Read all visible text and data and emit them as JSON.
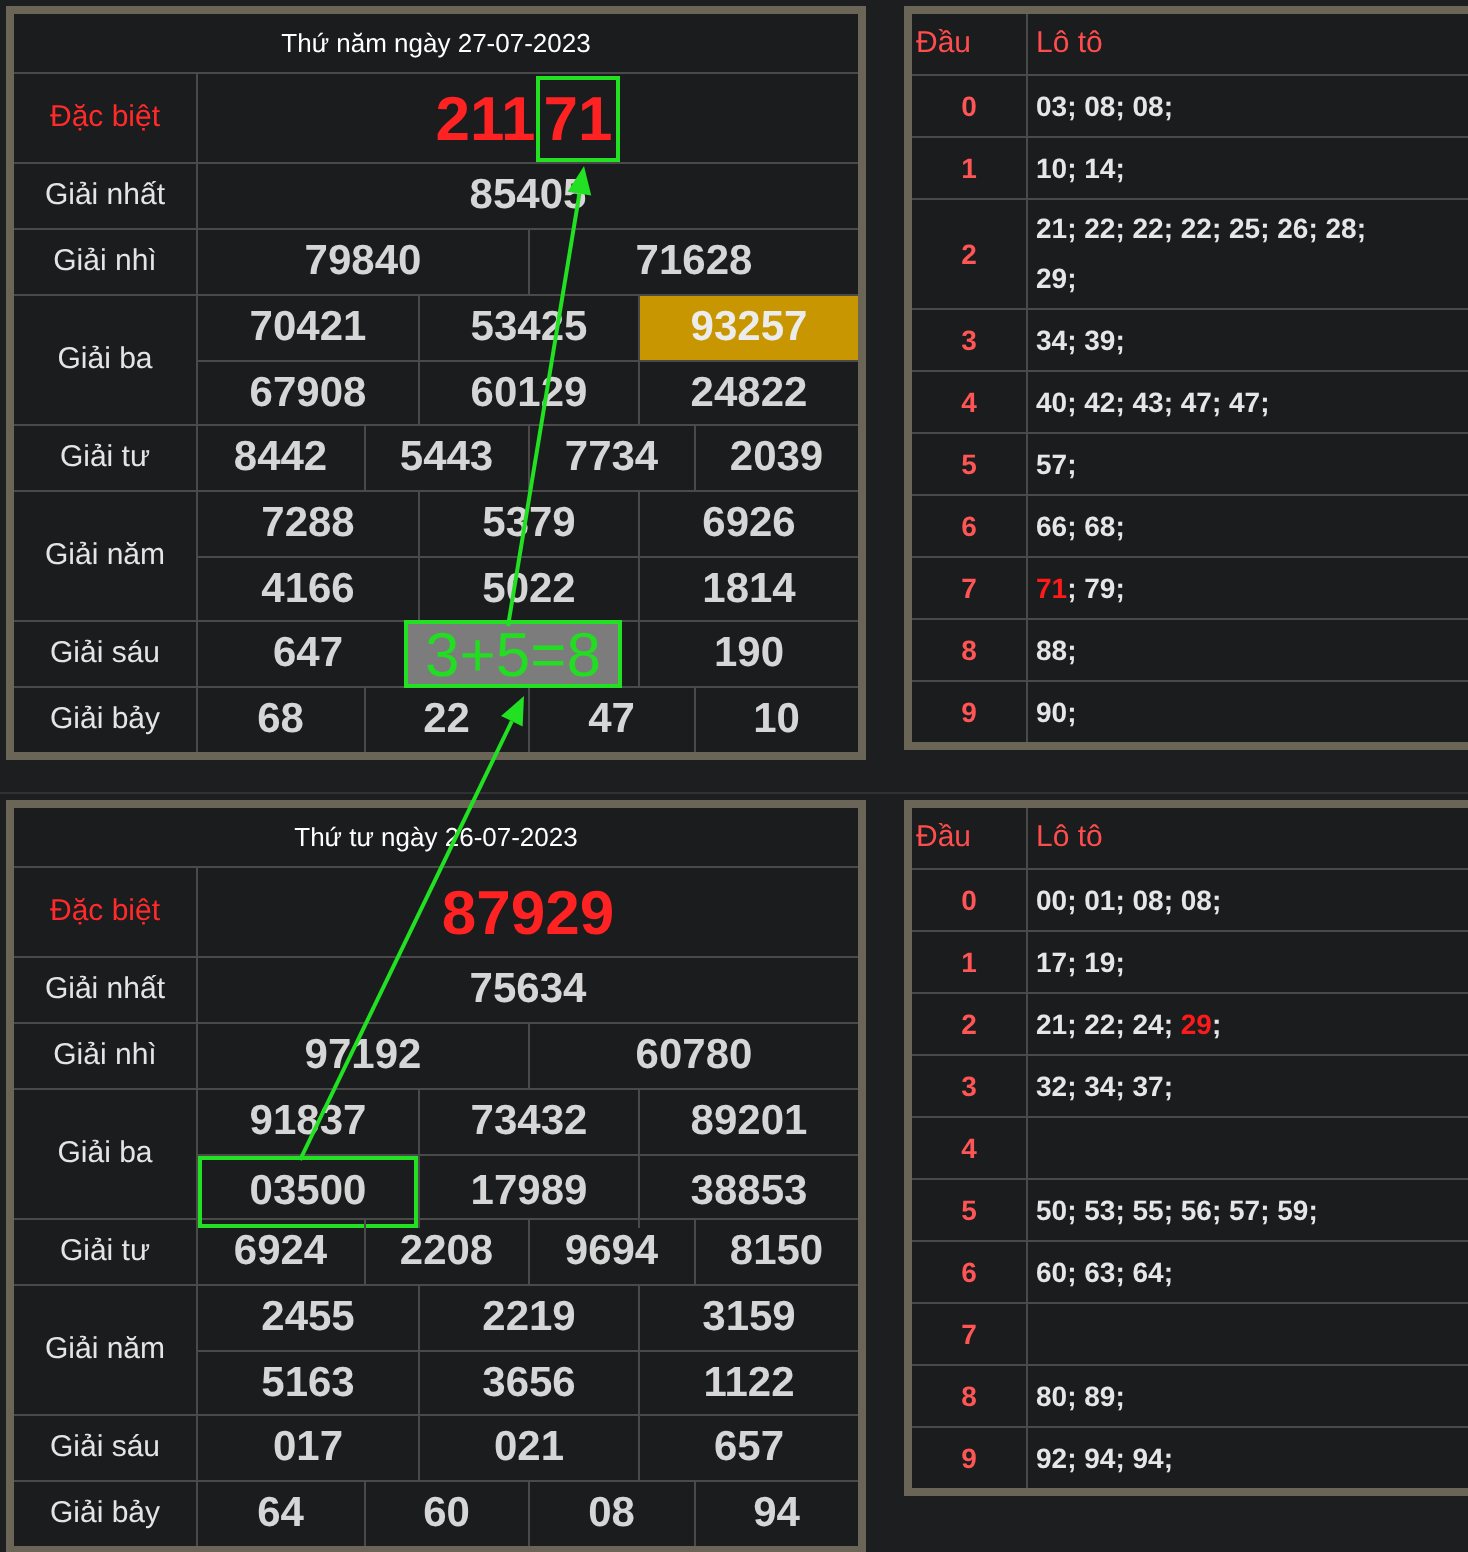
{
  "days": [
    {
      "date": "Thứ năm ngày 27-07-2023",
      "prizes": [
        {
          "label": "Đặc biệt",
          "kind": "special",
          "rows": [
            [
              {
                "parts": [
                  {
                    "text": "211",
                    "boxed": false
                  },
                  {
                    "text": "71",
                    "boxed": true
                  }
                ]
              }
            ]
          ]
        },
        {
          "label": "Giải nhất",
          "kind": "normal",
          "rows": [
            [
              {
                "value": "85405",
                "highlighted": false,
                "boxed": false
              }
            ]
          ]
        },
        {
          "label": "Giải nhì",
          "kind": "normal",
          "rows": [
            [
              {
                "value": "79840",
                "highlighted": false,
                "boxed": false
              },
              {
                "value": "71628",
                "highlighted": false,
                "boxed": false
              }
            ]
          ]
        },
        {
          "label": "Giải ba",
          "kind": "normal",
          "rows": [
            [
              {
                "value": "70421",
                "highlighted": false,
                "boxed": false
              },
              {
                "value": "53425",
                "highlighted": false,
                "boxed": false
              },
              {
                "value": "93257",
                "highlighted": true,
                "boxed": false
              }
            ],
            [
              {
                "value": "67908",
                "highlighted": false,
                "boxed": false
              },
              {
                "value": "60129",
                "highlighted": false,
                "boxed": false
              },
              {
                "value": "24822",
                "highlighted": false,
                "boxed": false
              }
            ]
          ]
        },
        {
          "label": "Giải tư",
          "kind": "normal",
          "rows": [
            [
              {
                "value": "8442",
                "highlighted": false,
                "boxed": false
              },
              {
                "value": "5443",
                "highlighted": false,
                "boxed": false
              },
              {
                "value": "7734",
                "highlighted": false,
                "boxed": false
              },
              {
                "value": "2039",
                "highlighted": false,
                "boxed": false
              }
            ]
          ]
        },
        {
          "label": "Giải năm",
          "kind": "normal",
          "rows": [
            [
              {
                "value": "7288",
                "highlighted": false,
                "boxed": false
              },
              {
                "value": "5379",
                "highlighted": false,
                "boxed": false
              },
              {
                "value": "6926",
                "highlighted": false,
                "boxed": false
              }
            ],
            [
              {
                "value": "4166",
                "highlighted": false,
                "boxed": false
              },
              {
                "value": "5022",
                "highlighted": false,
                "boxed": false
              },
              {
                "value": "1814",
                "highlighted": false,
                "boxed": false
              }
            ]
          ]
        },
        {
          "label": "Giải sáu",
          "kind": "normal",
          "rows": [
            [
              {
                "value": "647",
                "highlighted": false,
                "boxed": false
              },
              {
                "overlay": "3+5=8",
                "highlighted": false,
                "boxed": false
              },
              {
                "value": "190",
                "highlighted": false,
                "boxed": false
              }
            ]
          ]
        },
        {
          "label": "Giải bảy",
          "kind": "normal",
          "rows": [
            [
              {
                "value": "68",
                "highlighted": false,
                "boxed": false
              },
              {
                "value": "22",
                "highlighted": false,
                "boxed": false
              },
              {
                "value": "47",
                "highlighted": false,
                "boxed": false
              },
              {
                "value": "10",
                "highlighted": false,
                "boxed": false
              }
            ]
          ]
        }
      ],
      "lotto_header": {
        "head": "Đầu",
        "numbers": "Lô tô"
      },
      "lotto": [
        {
          "head": "0",
          "segments": [
            {
              "text": "03; 08; 08;",
              "highlighted": false
            }
          ]
        },
        {
          "head": "1",
          "segments": [
            {
              "text": "10; 14;",
              "highlighted": false
            }
          ]
        },
        {
          "head": "2",
          "segments": [
            {
              "text": "21; 22; 22; 22; 25; 26; 28; 29;",
              "highlighted": false
            }
          ]
        },
        {
          "head": "3",
          "segments": [
            {
              "text": "34; 39;",
              "highlighted": false
            }
          ]
        },
        {
          "head": "4",
          "segments": [
            {
              "text": "40; 42; 43; 47; 47;",
              "highlighted": false
            }
          ]
        },
        {
          "head": "5",
          "segments": [
            {
              "text": "57;",
              "highlighted": false
            }
          ]
        },
        {
          "head": "6",
          "segments": [
            {
              "text": "66; 68;",
              "highlighted": false
            }
          ]
        },
        {
          "head": "7",
          "segments": [
            {
              "text": "71",
              "highlighted": true
            },
            {
              "text": "; 79;",
              "highlighted": false
            }
          ]
        },
        {
          "head": "8",
          "segments": [
            {
              "text": "88;",
              "highlighted": false
            }
          ]
        },
        {
          "head": "9",
          "segments": [
            {
              "text": "90;",
              "highlighted": false
            }
          ]
        }
      ]
    },
    {
      "date": "Thứ tư ngày 26-07-2023",
      "prizes": [
        {
          "label": "Đặc biệt",
          "kind": "special",
          "rows": [
            [
              {
                "parts": [
                  {
                    "text": "87929",
                    "boxed": false
                  }
                ]
              }
            ]
          ]
        },
        {
          "label": "Giải nhất",
          "kind": "normal",
          "rows": [
            [
              {
                "value": "75634",
                "highlighted": false,
                "boxed": false
              }
            ]
          ]
        },
        {
          "label": "Giải nhì",
          "kind": "normal",
          "rows": [
            [
              {
                "value": "97192",
                "highlighted": false,
                "boxed": false
              },
              {
                "value": "60780",
                "highlighted": false,
                "boxed": false
              }
            ]
          ]
        },
        {
          "label": "Giải ba",
          "kind": "normal",
          "rows": [
            [
              {
                "value": "91837",
                "highlighted": false,
                "boxed": false
              },
              {
                "value": "73432",
                "highlighted": false,
                "boxed": false
              },
              {
                "value": "89201",
                "highlighted": false,
                "boxed": false
              }
            ],
            [
              {
                "value": "03500",
                "highlighted": false,
                "boxed": true
              },
              {
                "value": "17989",
                "highlighted": false,
                "boxed": false
              },
              {
                "value": "38853",
                "highlighted": false,
                "boxed": false
              }
            ]
          ]
        },
        {
          "label": "Giải tư",
          "kind": "normal",
          "rows": [
            [
              {
                "value": "6924",
                "highlighted": false,
                "boxed": false
              },
              {
                "value": "2208",
                "highlighted": false,
                "boxed": false
              },
              {
                "value": "9694",
                "highlighted": false,
                "boxed": false
              },
              {
                "value": "8150",
                "highlighted": false,
                "boxed": false
              }
            ]
          ]
        },
        {
          "label": "Giải năm",
          "kind": "normal",
          "rows": [
            [
              {
                "value": "2455",
                "highlighted": false,
                "boxed": false
              },
              {
                "value": "2219",
                "highlighted": false,
                "boxed": false
              },
              {
                "value": "3159",
                "highlighted": false,
                "boxed": false
              }
            ],
            [
              {
                "value": "5163",
                "highlighted": false,
                "boxed": false
              },
              {
                "value": "3656",
                "highlighted": false,
                "boxed": false
              },
              {
                "value": "1122",
                "highlighted": false,
                "boxed": false
              }
            ]
          ]
        },
        {
          "label": "Giải sáu",
          "kind": "normal",
          "rows": [
            [
              {
                "value": "017",
                "highlighted": false,
                "boxed": false
              },
              {
                "value": "021",
                "highlighted": false,
                "boxed": false
              },
              {
                "value": "657",
                "highlighted": false,
                "boxed": false
              }
            ]
          ]
        },
        {
          "label": "Giải bảy",
          "kind": "normal",
          "rows": [
            [
              {
                "value": "64",
                "highlighted": false,
                "boxed": false
              },
              {
                "value": "60",
                "highlighted": false,
                "boxed": false
              },
              {
                "value": "08",
                "highlighted": false,
                "boxed": false
              },
              {
                "value": "94",
                "highlighted": false,
                "boxed": false
              }
            ]
          ]
        }
      ],
      "lotto_header": {
        "head": "Đầu",
        "numbers": "Lô tô"
      },
      "lotto": [
        {
          "head": "0",
          "segments": [
            {
              "text": "00; 01; 08; 08;",
              "highlighted": false
            }
          ]
        },
        {
          "head": "1",
          "segments": [
            {
              "text": "17; 19;",
              "highlighted": false
            }
          ]
        },
        {
          "head": "2",
          "segments": [
            {
              "text": "21; 22; 24; ",
              "highlighted": false
            },
            {
              "text": "29",
              "highlighted": true
            },
            {
              "text": ";",
              "highlighted": false
            }
          ]
        },
        {
          "head": "3",
          "segments": [
            {
              "text": "32; 34; 37;",
              "highlighted": false
            }
          ]
        },
        {
          "head": "4"
        },
        {
          "head": "5",
          "segments": [
            {
              "text": "50; 53; 55; 56; 57; 59;",
              "highlighted": false
            }
          ]
        },
        {
          "head": "6",
          "segments": [
            {
              "text": "60; 63; 64;",
              "highlighted": false
            }
          ]
        },
        {
          "head": "7"
        },
        {
          "head": "8",
          "segments": [
            {
              "text": "80; 89;",
              "highlighted": false
            }
          ]
        },
        {
          "head": "9",
          "segments": [
            {
              "text": "92; 94; 94;",
              "highlighted": false
            }
          ]
        }
      ]
    }
  ]
}
